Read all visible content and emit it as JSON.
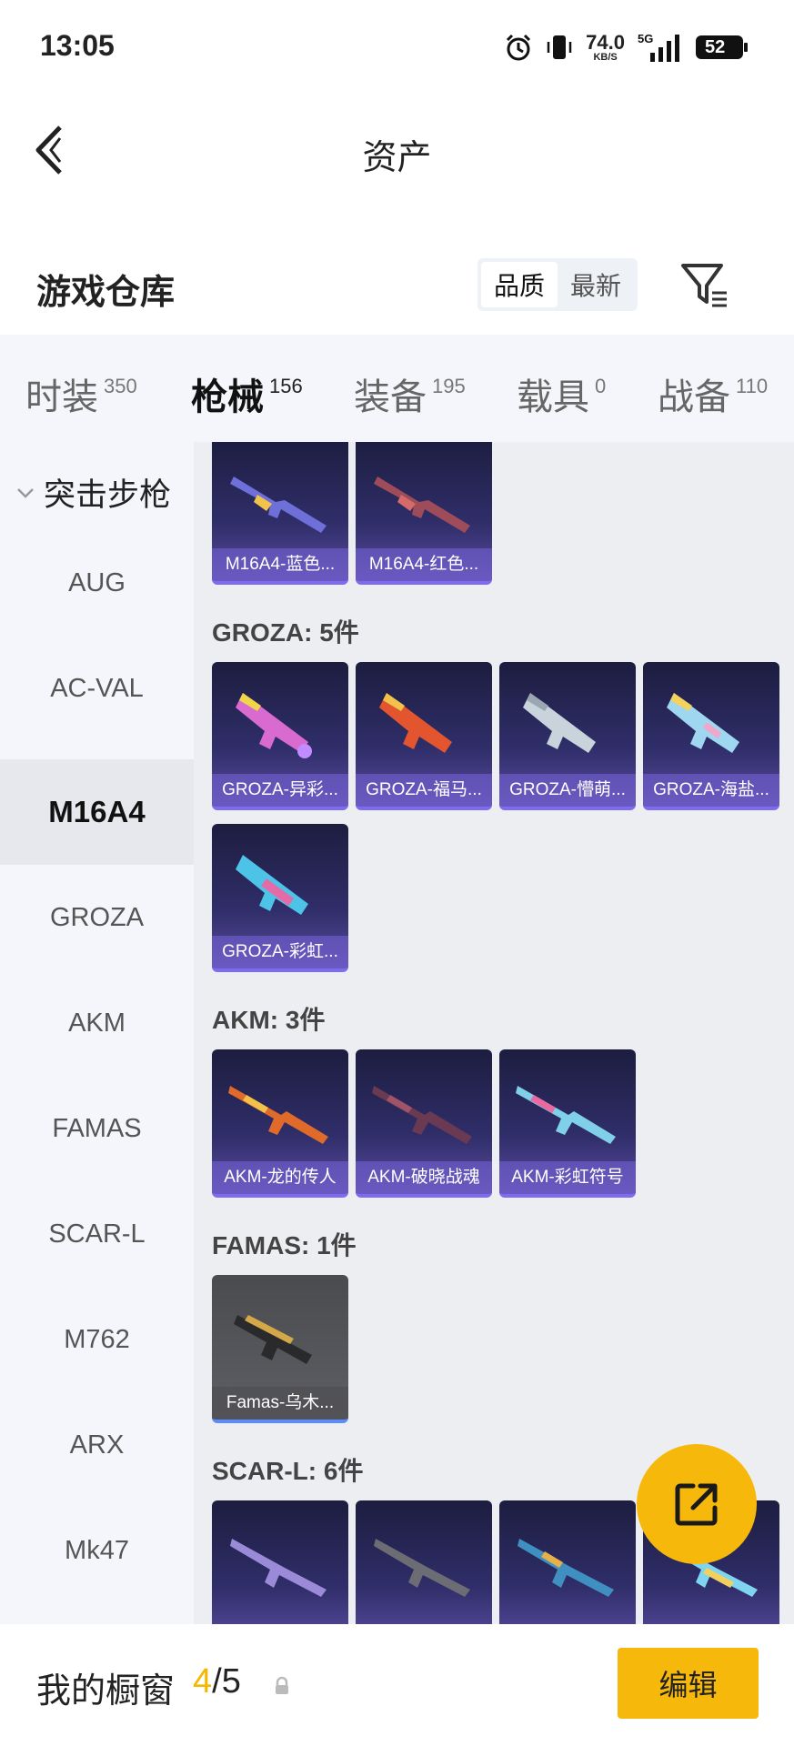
{
  "status_bar": {
    "time": "13:05",
    "net_speed": "74.0",
    "net_unit": "KB/S",
    "signal_label": "5G",
    "battery": "52"
  },
  "nav": {
    "title": "资产"
  },
  "warehouse": {
    "title": "游戏仓库",
    "sort_options": [
      "品质",
      "最新"
    ],
    "selected_sort": "品质"
  },
  "tabs": [
    {
      "label": "时装",
      "count": "350"
    },
    {
      "label": "枪械",
      "count": "156",
      "active": true
    },
    {
      "label": "装备",
      "count": "195"
    },
    {
      "label": "载具",
      "count": "0"
    },
    {
      "label": "战备",
      "count": "110"
    }
  ],
  "sidebar": {
    "group": "突击步枪",
    "items": [
      "AUG",
      "AC-VAL",
      "M16A4",
      "GROZA",
      "AKM",
      "FAMAS",
      "SCAR-L",
      "M762",
      "ARX",
      "Mk47"
    ],
    "selected": "M16A4"
  },
  "sections": {
    "m16a4": {
      "items": [
        "M16A4-蓝色...",
        "M16A4-红色..."
      ]
    },
    "groza": {
      "title": "GROZA: 5件",
      "items": [
        "GROZA-异彩...",
        "GROZA-福马...",
        "GROZA-懵萌...",
        "GROZA-海盐...",
        "GROZA-彩虹..."
      ]
    },
    "akm": {
      "title": "AKM: 3件",
      "items": [
        "AKM-龙的传人",
        "AKM-破晓战魂",
        "AKM-彩虹符号"
      ]
    },
    "famas": {
      "title": "FAMAS: 1件",
      "items": [
        "Famas-乌木..."
      ]
    },
    "scarl": {
      "title": "SCAR-L: 6件"
    }
  },
  "bottom_bar": {
    "label": "我的橱窗",
    "current": "4",
    "total": "/5",
    "edit_label": "编辑"
  },
  "colors": {
    "accent": "#f7b80c",
    "card_bg": "#302e6a",
    "tab_bar": "#f5bf0f"
  }
}
